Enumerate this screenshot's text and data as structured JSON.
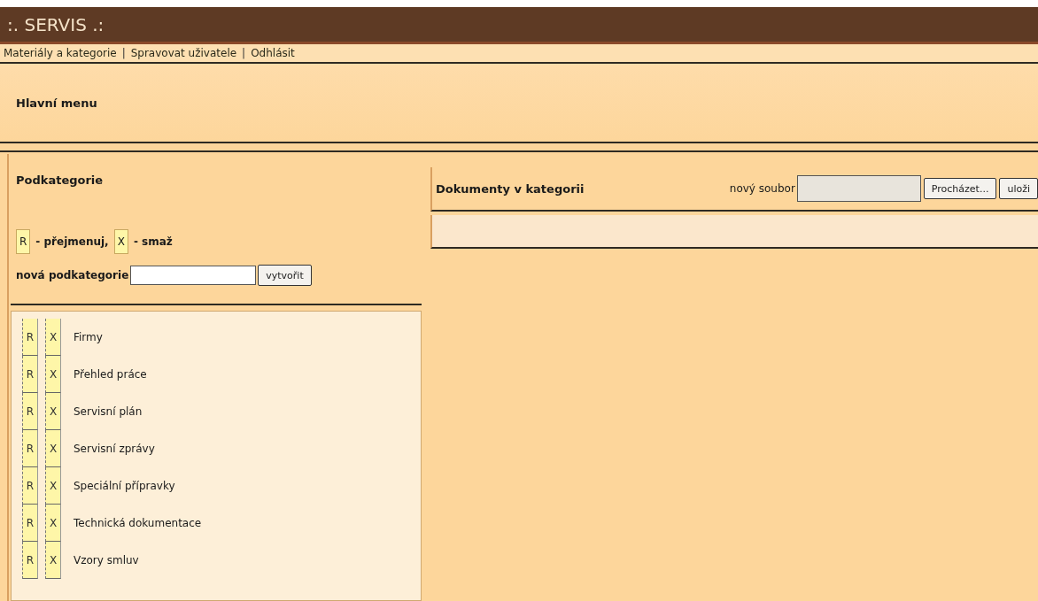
{
  "header": {
    "title": ":. SERVIS .:"
  },
  "nav": [
    {
      "label": "Materiály a kategorie"
    },
    {
      "label": "Spravovat uživatele"
    },
    {
      "label": "Odhlásit"
    }
  ],
  "nav_separator": "|",
  "main_menu": {
    "title": "Hlavní menu"
  },
  "subcategories": {
    "title": "Podkategorie",
    "legend": [
      {
        "key": "R",
        "text": "- přejmenuj,"
      },
      {
        "key": "X",
        "text": "- smaž"
      }
    ],
    "new_label": "nová podkategorie",
    "create_button": "vytvořit",
    "items": [
      {
        "rename": "R",
        "delete": "X",
        "name": "Firmy"
      },
      {
        "rename": "R",
        "delete": "X",
        "name": "Přehled práce"
      },
      {
        "rename": "R",
        "delete": "X",
        "name": "Servisní plán"
      },
      {
        "rename": "R",
        "delete": "X",
        "name": "Servisní zprávy"
      },
      {
        "rename": "R",
        "delete": "X",
        "name": "Speciální přípravky"
      },
      {
        "rename": "R",
        "delete": "X",
        "name": "Technická dokumentace"
      },
      {
        "rename": "R",
        "delete": "X",
        "name": "Vzory smluv"
      }
    ]
  },
  "documents": {
    "title": "Dokumenty v kategorii",
    "file_label": "nový soubor",
    "browse_button": "Procházet...",
    "save_button": "uloži"
  }
}
